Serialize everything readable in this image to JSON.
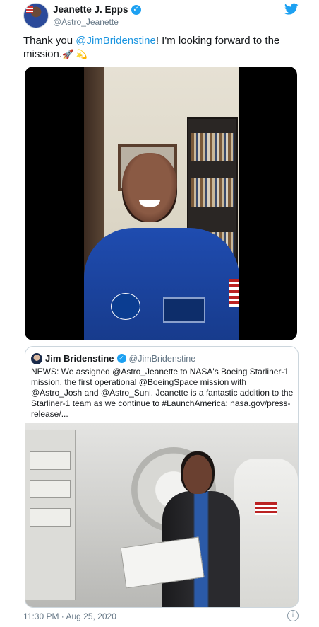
{
  "author": {
    "display_name": "Jeanette J. Epps",
    "handle": "@Astro_Jeanette",
    "verified_icon": "✓"
  },
  "tweet": {
    "prefix": "Thank you ",
    "mention": "@JimBridenstine",
    "suffix": "! I'm looking forward to the mission.",
    "emoji": "🚀 💫"
  },
  "quoted": {
    "display_name": "Jim Bridenstine",
    "handle": "@JimBridenstine",
    "verified_icon": "✓",
    "text": "NEWS: We assigned @Astro_Jeanette to NASA's Boeing Starliner-1 mission, the first operational @BoeingSpace mission with @Astro_Josh and @Astro_Suni. Jeanette is a fantastic addition to the Starliner-1 team as we continue to #LaunchAmerica: nasa.gov/press-release/..."
  },
  "meta": {
    "timestamp": "11:30 PM · Aug 25, 2020",
    "info_icon": "i"
  },
  "icons": {
    "brand": "twitter-bird-icon",
    "verified": "verified-badge-icon",
    "info": "info-icon"
  },
  "colors": {
    "link": "#1b95e0",
    "brand": "#1da1f2",
    "muted": "#657786"
  }
}
